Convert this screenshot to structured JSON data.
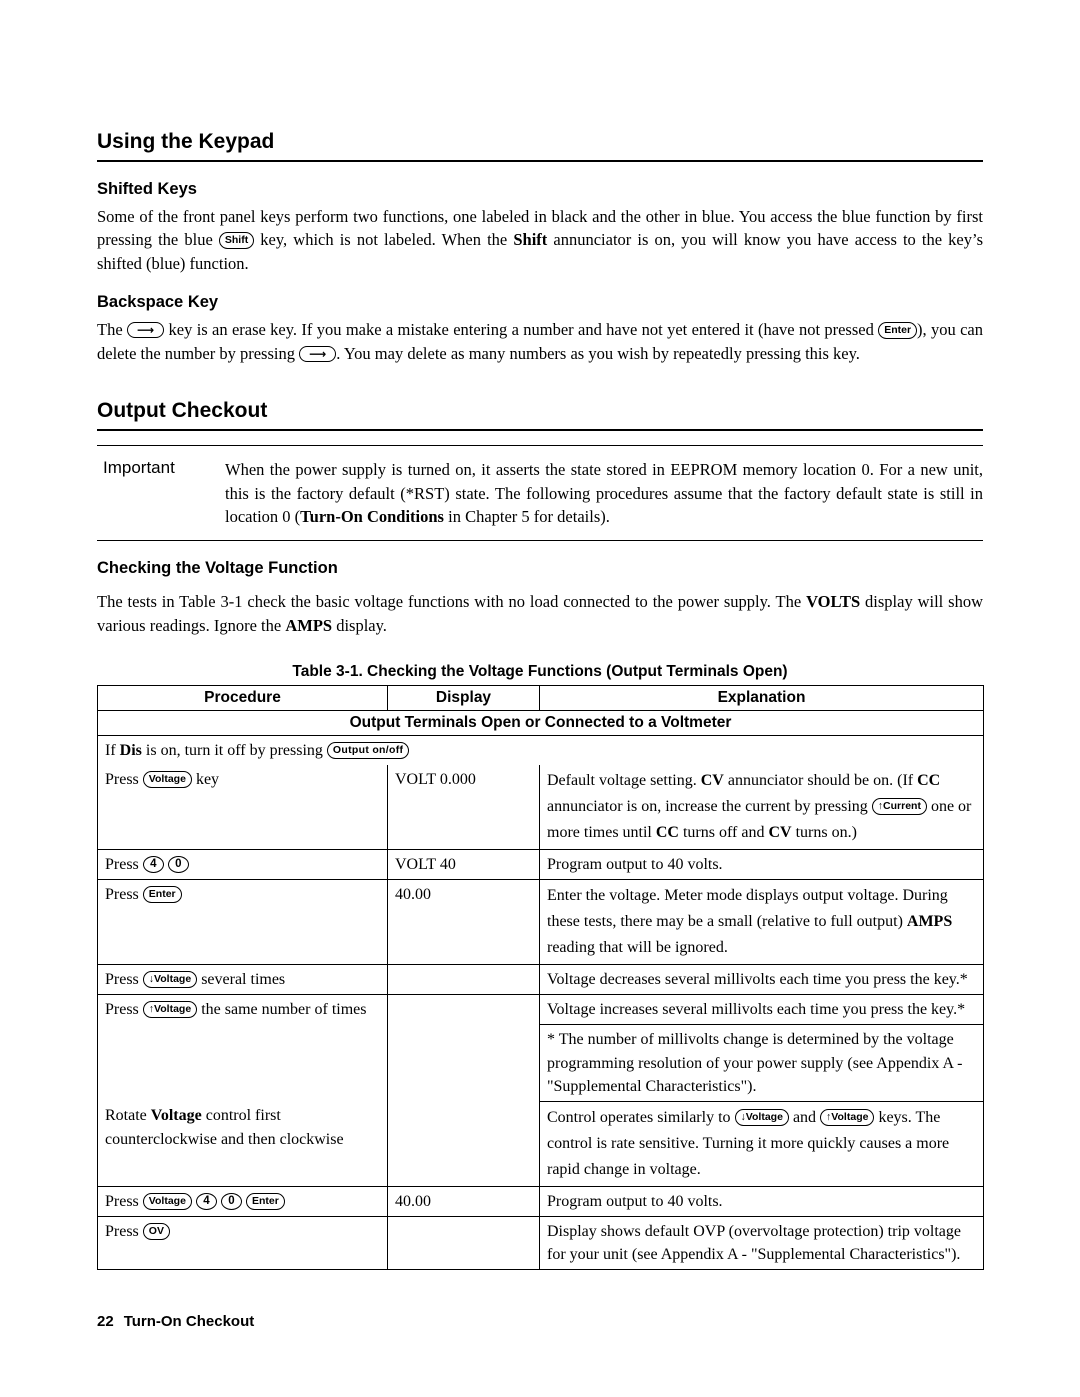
{
  "doc": {
    "sections": {
      "keypad_title": "Using the Keypad",
      "shifted_keys_title": "Shifted Keys",
      "shifted_p1_a": "Some of the front panel keys perform two functions, one labeled in black and the other in blue. You access the blue function by first pressing the blue ",
      "shifted_key_shift": "Shift",
      "shifted_p1_b": " key, which is not labeled. When the ",
      "shifted_bold_shift": "Shift",
      "shifted_p1_c": " annunciator is on, you will know you have access to the key’s shifted (blue) function.",
      "backspace_title": "Backspace Key",
      "backspace_a": "The ",
      "backspace_b": " key is an erase key. If you make a mistake entering a number and have not yet entered it (have not pressed ",
      "key_enter": "Enter",
      "backspace_c": "), you can delete the number by pressing ",
      "backspace_d": ". You may delete as many numbers as you wish by repeatedly pressing this key.",
      "output_checkout_title": "Output Checkout",
      "important_label": "Important",
      "important_a": "When the power supply is turned on, it asserts the state stored in EEPROM memory location 0. For a new unit, this is the factory default (*RST) state. The following procedures assume that the factory default state is still in location 0 (",
      "important_bold": "Turn-On Conditions",
      "important_b": " in Chapter 5 for details).",
      "checking_voltage_title": "Checking the Voltage Function",
      "checking_p_a": "The tests in Table 3-1 check the basic voltage functions with no load connected to the power supply. The ",
      "checking_bold_volts": "VOLTS",
      "checking_p_b": " display will show various readings. Ignore the ",
      "checking_bold_amps": "AMPS",
      "checking_p_c": " display."
    },
    "table": {
      "caption": "Table 3-1. Checking the Voltage Functions (Output Terminals Open)",
      "headers": [
        "Procedure",
        "Display",
        "Explanation"
      ],
      "subheader": "Output Terminals Open or Connected to a Voltmeter",
      "rows": [
        {
          "proc_a": "If ",
          "proc_bold": "Dis",
          "proc_b": " is on, turn it off by pressing ",
          "proc_key": "Output on/off",
          "display": "",
          "explanation": ""
        },
        {
          "proc_a": "Press ",
          "proc_key": "Voltage",
          "proc_b": " key",
          "display": "VOLT 0.000",
          "exp_a": "Default voltage setting. ",
          "exp_bold1": "CV",
          "exp_b": " annunciator should be on. (If ",
          "exp_bold2": "CC",
          "exp_c": " annunciator is on, increase the current by pressing ",
          "exp_key": "↑Current",
          "exp_d": " one or more times until ",
          "exp_bold3": "CC",
          "exp_e": " turns off and ",
          "exp_bold4": "CV",
          "exp_f": " turns on.)"
        },
        {
          "proc_a": "Press ",
          "proc_key1": "4",
          "proc_key2": "0",
          "display": "VOLT 40",
          "explanation": "Program output to 40 volts."
        },
        {
          "proc_a": "Press ",
          "proc_key": "Enter",
          "display": "40.00",
          "exp_a": "Enter the voltage. Meter mode displays output voltage. During these tests, there may be a small (relative to full output) ",
          "exp_bold": "AMPS",
          "exp_b": " reading that will be ignored."
        },
        {
          "proc_a": "Press ",
          "proc_key": "↓Voltage",
          "proc_b": " several times",
          "display": "",
          "explanation": "Voltage decreases several millivolts each time you press the key.*"
        },
        {
          "proc_a": "Press ",
          "proc_key": "↑Voltage",
          "proc_b": " the same number of times",
          "display": "",
          "explanation": "Voltage increases several millivolts each time you press the key.*"
        },
        {
          "footnote": "* The number of millivolts change is determined by the voltage programming resolution of your power supply (see Appendix A -\"Supplemental Characteristics\")."
        },
        {
          "proc_a": "Rotate ",
          "proc_bold": "Voltage",
          "proc_b": " control first counterclockwise and then clockwise",
          "display": "",
          "exp_a": "Control operates similarly to ",
          "exp_key1": "↓Voltage",
          "exp_b": " and ",
          "exp_key2": "↑Voltage",
          "exp_c": " keys. The control is rate sensitive. Turning it more quickly causes a more rapid change in voltage."
        },
        {
          "proc_a": "Press ",
          "proc_key1": "Voltage",
          "proc_key2": "4",
          "proc_key3": "0",
          "proc_key4": "Enter",
          "display": "40.00",
          "explanation": "Program output to 40 volts."
        },
        {
          "proc_a": "Press ",
          "proc_key": "OV",
          "display": "",
          "explanation": "Display shows default OVP (overvoltage protection) trip voltage for your unit (see Appendix A - \"Supplemental Characteristics\")."
        }
      ]
    },
    "footer": {
      "page_number": "22",
      "chapter": "Turn-On Checkout"
    }
  }
}
